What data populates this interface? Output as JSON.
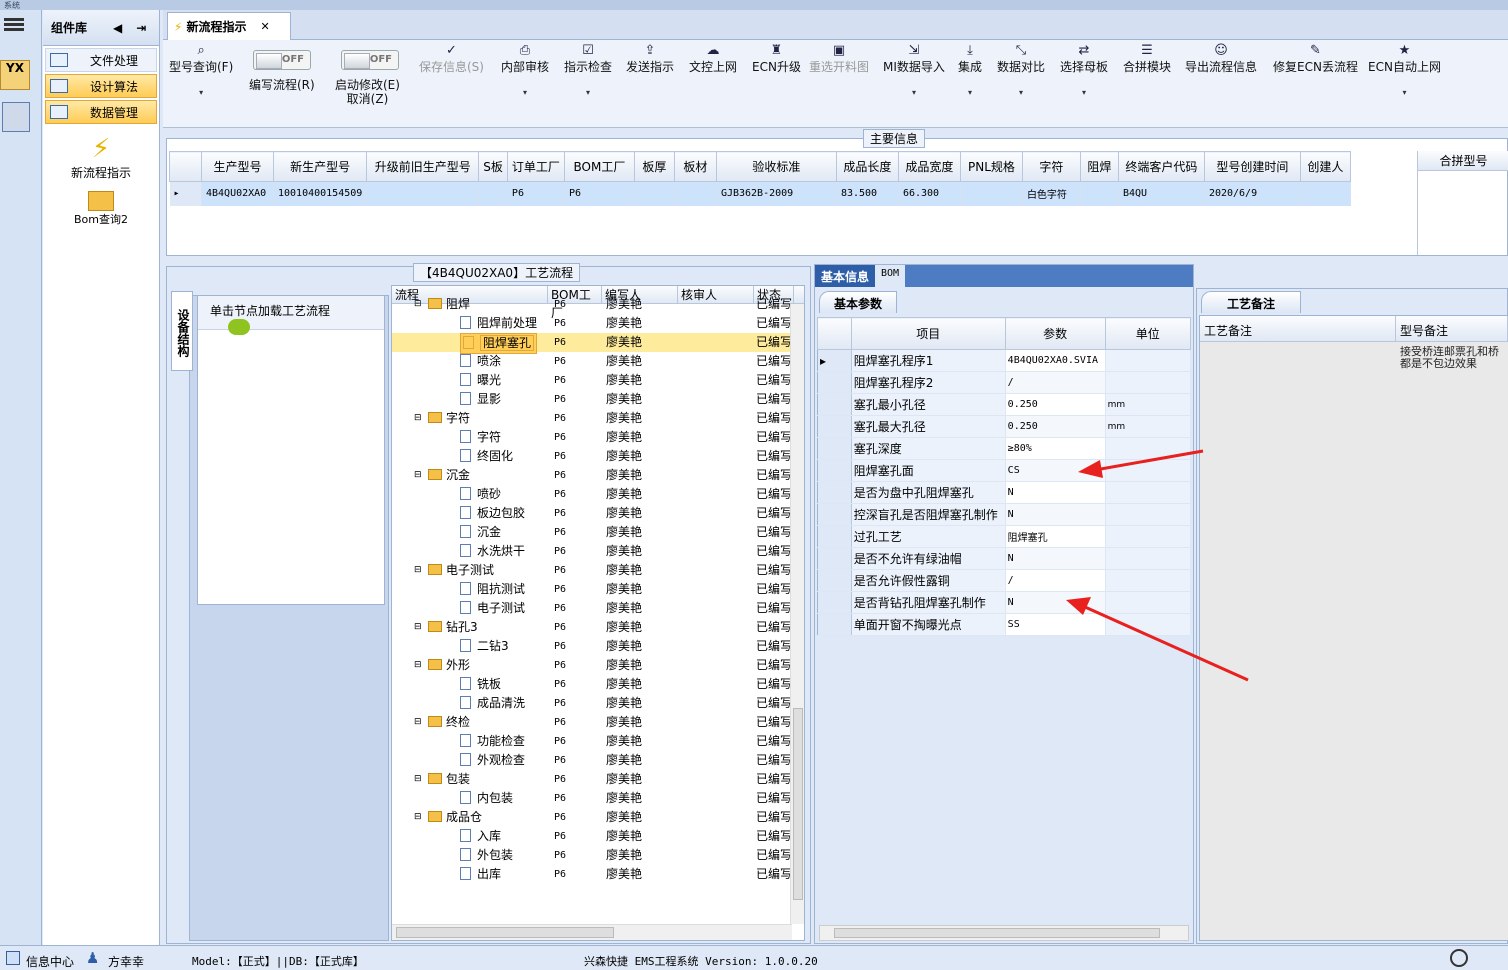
{
  "window": {
    "title": "系统"
  },
  "left_icons": [
    "menu-icon",
    "yx-logo-icon",
    "tool-icon"
  ],
  "component_library": {
    "title": "组件库",
    "items": [
      {
        "label": "文件处理"
      },
      {
        "label": "设计算法"
      },
      {
        "label": "数据管理"
      }
    ],
    "tools": [
      {
        "label": "新流程指示"
      },
      {
        "label": "Bom查询2"
      }
    ]
  },
  "tab": {
    "label": "新流程指示"
  },
  "toolbar": {
    "type_query": "型号查询(F)",
    "write_flow_toggle": "OFF",
    "write_flow": "编写流程(R)",
    "start_modify_toggle": "OFF",
    "start_modify": "启动修改(E)",
    "cancel": "取消(Z)",
    "save_info": "保存信息(S)",
    "internal_review": "内部审核",
    "check_instruction": "指示检查",
    "send_instruction": "发送指示",
    "upload_doc": "文控上网",
    "ecn_upgrade": "ECN升级",
    "reselect_feed": "重选开料图",
    "mi_import": "MI数据导入",
    "integrate": "集成",
    "data_compare": "数据对比",
    "select_board": "选择母板",
    "merge_module": "合拼模块",
    "export_flow": "导出流程信息",
    "fix_ecn": "修复ECN丢流程",
    "ecn_auto_upload": "ECN自动上网"
  },
  "main_info": {
    "legend": "主要信息",
    "columns": [
      "生产型号",
      "新生产型号",
      "升级前旧生产型号",
      "S板",
      "订单工厂",
      "BOM工厂",
      "板厚",
      "板材",
      "验收标准",
      "成品长度",
      "成品宽度",
      "PNL规格",
      "字符",
      "阻焊",
      "终端客户代码",
      "型号创建时间",
      "创建人"
    ],
    "row": [
      "4B4QU02XA0",
      "10010400154509",
      "",
      "",
      "P6",
      "P6",
      "",
      "",
      "GJB362B-2009",
      "83.500",
      "66.300",
      "",
      "白色字符",
      "",
      "B4QU",
      "2020/6/9",
      ""
    ],
    "side_column": "合拼型号"
  },
  "flow_panel": {
    "legend": "【4B4QU02XA0】工艺流程",
    "vertical_tab": "设备结构",
    "hint": "单击节点加载工艺流程",
    "columns": [
      "流程",
      "BOM工厂",
      "编写人",
      "核审人",
      "状态"
    ],
    "rows": [
      {
        "name": "阻焊",
        "type": "folder",
        "factory": "P6",
        "author": "廖美艳",
        "status": "已编写"
      },
      {
        "name": "阻焊前处理",
        "type": "leaf",
        "factory": "P6",
        "author": "廖美艳",
        "status": "已编写"
      },
      {
        "name": "阻焊塞孔",
        "type": "leaf",
        "factory": "P6",
        "author": "廖美艳",
        "status": "已编写",
        "selected": true
      },
      {
        "name": "喷涂",
        "type": "leaf",
        "factory": "P6",
        "author": "廖美艳",
        "status": "已编写"
      },
      {
        "name": "曝光",
        "type": "leaf",
        "factory": "P6",
        "author": "廖美艳",
        "status": "已编写"
      },
      {
        "name": "显影",
        "type": "leaf",
        "factory": "P6",
        "author": "廖美艳",
        "status": "已编写"
      },
      {
        "name": "字符",
        "type": "folder",
        "factory": "P6",
        "author": "廖美艳",
        "status": "已编写"
      },
      {
        "name": "字符",
        "type": "leaf",
        "factory": "P6",
        "author": "廖美艳",
        "status": "已编写"
      },
      {
        "name": "终固化",
        "type": "leaf",
        "factory": "P6",
        "author": "廖美艳",
        "status": "已编写"
      },
      {
        "name": "沉金",
        "type": "folder",
        "factory": "P6",
        "author": "廖美艳",
        "status": "已编写"
      },
      {
        "name": "喷砂",
        "type": "leaf",
        "factory": "P6",
        "author": "廖美艳",
        "status": "已编写"
      },
      {
        "name": "板边包胶",
        "type": "leaf",
        "factory": "P6",
        "author": "廖美艳",
        "status": "已编写"
      },
      {
        "name": "沉金",
        "type": "leaf",
        "factory": "P6",
        "author": "廖美艳",
        "status": "已编写"
      },
      {
        "name": "水洗烘干",
        "type": "leaf",
        "factory": "P6",
        "author": "廖美艳",
        "status": "已编写"
      },
      {
        "name": "电子测试",
        "type": "folder",
        "factory": "P6",
        "author": "廖美艳",
        "status": "已编写"
      },
      {
        "name": "阻抗测试",
        "type": "leaf",
        "factory": "P6",
        "author": "廖美艳",
        "status": "已编写"
      },
      {
        "name": "电子测试",
        "type": "leaf",
        "factory": "P6",
        "author": "廖美艳",
        "status": "已编写"
      },
      {
        "name": "钻孔3",
        "type": "folder",
        "factory": "P6",
        "author": "廖美艳",
        "status": "已编写"
      },
      {
        "name": "二钻3",
        "type": "leaf",
        "factory": "P6",
        "author": "廖美艳",
        "status": "已编写"
      },
      {
        "name": "外形",
        "type": "folder",
        "factory": "P6",
        "author": "廖美艳",
        "status": "已编写"
      },
      {
        "name": "铣板",
        "type": "leaf",
        "factory": "P6",
        "author": "廖美艳",
        "status": "已编写"
      },
      {
        "name": "成品清洗",
        "type": "leaf",
        "factory": "P6",
        "author": "廖美艳",
        "status": "已编写"
      },
      {
        "name": "终检",
        "type": "folder",
        "factory": "P6",
        "author": "廖美艳",
        "status": "已编写"
      },
      {
        "name": "功能检查",
        "type": "leaf",
        "factory": "P6",
        "author": "廖美艳",
        "status": "已编写"
      },
      {
        "name": "外观检查",
        "type": "leaf",
        "factory": "P6",
        "author": "廖美艳",
        "status": "已编写"
      },
      {
        "name": "包装",
        "type": "folder",
        "factory": "P6",
        "author": "廖美艳",
        "status": "已编写"
      },
      {
        "name": "内包装",
        "type": "leaf",
        "factory": "P6",
        "author": "廖美艳",
        "status": "已编写"
      },
      {
        "name": "成品仓",
        "type": "folder",
        "factory": "P6",
        "author": "廖美艳",
        "status": "已编写"
      },
      {
        "name": "入库",
        "type": "leaf",
        "factory": "P6",
        "author": "廖美艳",
        "status": "已编写"
      },
      {
        "name": "外包装",
        "type": "leaf",
        "factory": "P6",
        "author": "廖美艳",
        "status": "已编写"
      },
      {
        "name": "出库",
        "type": "leaf",
        "factory": "P6",
        "author": "廖美艳",
        "status": "已编写"
      }
    ]
  },
  "info_panel": {
    "tab_basic": "基本信息",
    "tab_bom": "BOM",
    "subtab": "基本参数",
    "columns": [
      "项目",
      "参数",
      "单位"
    ],
    "params": [
      {
        "item": "阻焊塞孔程序1",
        "value": "4B4QU02XA0.SVIA",
        "unit": ""
      },
      {
        "item": "阻焊塞孔程序2",
        "value": "/",
        "unit": ""
      },
      {
        "item": "塞孔最小孔径",
        "value": "0.250",
        "unit": "mm"
      },
      {
        "item": "塞孔最大孔径",
        "value": "0.250",
        "unit": "mm"
      },
      {
        "item": "塞孔深度",
        "value": "≥80%",
        "unit": ""
      },
      {
        "item": "阻焊塞孔面",
        "value": "CS",
        "unit": ""
      },
      {
        "item": "是否为盘中孔阻焊塞孔",
        "value": "N",
        "unit": ""
      },
      {
        "item": "控深盲孔是否阻焊塞孔制作",
        "value": "N",
        "unit": ""
      },
      {
        "item": "过孔工艺",
        "value": "阻焊塞孔",
        "unit": ""
      },
      {
        "item": "是否不允许有绿油帽",
        "value": "N",
        "unit": ""
      },
      {
        "item": "是否允许假性露铜",
        "value": "/",
        "unit": ""
      },
      {
        "item": "是否背钻孔阻焊塞孔制作",
        "value": "N",
        "unit": ""
      },
      {
        "item": "单面开窗不掏曝光点",
        "value": "SS",
        "unit": ""
      }
    ]
  },
  "notes_panel": {
    "subtab": "工艺备注",
    "col1": "工艺备注",
    "col2": "型号备注",
    "note_line1": "接受桥连邮票孔和桥",
    "note_line2": "都是不包边效果"
  },
  "statusbar": {
    "info_center": "信息中心",
    "user": "方幸幸",
    "model": "Model:【正式】||DB:【正式库】",
    "system": "兴森快捷 EMS工程系统 Version: 1.0.0.20"
  },
  "colors": {
    "arrow": "#e8201e",
    "selection": "#ffeb9c",
    "accent": "#2e5ea8"
  }
}
